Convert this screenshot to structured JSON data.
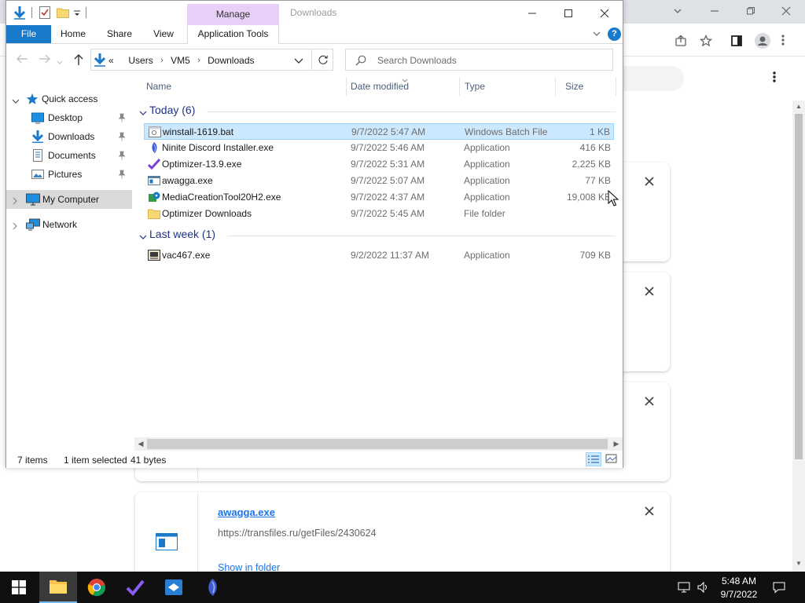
{
  "explorer": {
    "title": "Downloads",
    "manage_tab": "Manage",
    "ribbon_tabs": {
      "file": "File",
      "home": "Home",
      "share": "Share",
      "view": "View",
      "app_tools": "Application Tools"
    },
    "help": "?",
    "address": {
      "overflow": "«",
      "crumbs": [
        "Users",
        "VM5",
        "Downloads"
      ]
    },
    "search_placeholder": "Search Downloads",
    "nav": {
      "quick_access": "Quick access",
      "desktop": "Desktop",
      "downloads": "Downloads",
      "documents": "Documents",
      "pictures": "Pictures",
      "my_computer": "My Computer",
      "network": "Network"
    },
    "columns": {
      "name": "Name",
      "date": "Date modified",
      "type": "Type",
      "size": "Size"
    },
    "groups": {
      "today": "Today (6)",
      "last_week": "Last week (1)"
    },
    "files_today": [
      {
        "name": "winstall-1619.bat",
        "date": "9/7/2022 5:47 AM",
        "type": "Windows Batch File",
        "size": "1 KB",
        "icon": "batch-file-icon"
      },
      {
        "name": "Ninite Discord Installer.exe",
        "date": "9/7/2022 5:46 AM",
        "type": "Application",
        "size": "416 KB",
        "icon": "ninite-icon"
      },
      {
        "name": "Optimizer-13.9.exe",
        "date": "9/7/2022 5:31 AM",
        "type": "Application",
        "size": "2,225 KB",
        "icon": "optimizer-icon"
      },
      {
        "name": "awagga.exe",
        "date": "9/7/2022 5:07 AM",
        "type": "Application",
        "size": "77 KB",
        "icon": "exe-window-icon"
      },
      {
        "name": "MediaCreationTool20H2.exe",
        "date": "9/7/2022 4:37 AM",
        "type": "Application",
        "size": "19,008 KB",
        "icon": "media-creation-icon"
      },
      {
        "name": "Optimizer Downloads",
        "date": "9/7/2022 5:45 AM",
        "type": "File folder",
        "size": "",
        "icon": "folder-icon"
      }
    ],
    "files_last_week": [
      {
        "name": "vac467.exe",
        "date": "9/2/2022 11:37 AM",
        "type": "Application",
        "size": "709 KB",
        "icon": "vac-icon"
      }
    ],
    "status": {
      "items": "7 items",
      "selected": "1 item selected",
      "bytes": "41 bytes"
    }
  },
  "browser": {
    "download_card": {
      "name": "awagga.exe",
      "url": "https://transfiles.ru/getFiles/2430624",
      "show_in_folder": "Show in folder"
    }
  },
  "taskbar": {
    "time": "5:48 AM",
    "date": "9/7/2022"
  },
  "colors": {
    "accent": "#1979ca",
    "selection": "#cce8ff",
    "manage_tab": "#e8cff8",
    "group_header": "#1e3287",
    "link": "#1a73e8"
  }
}
